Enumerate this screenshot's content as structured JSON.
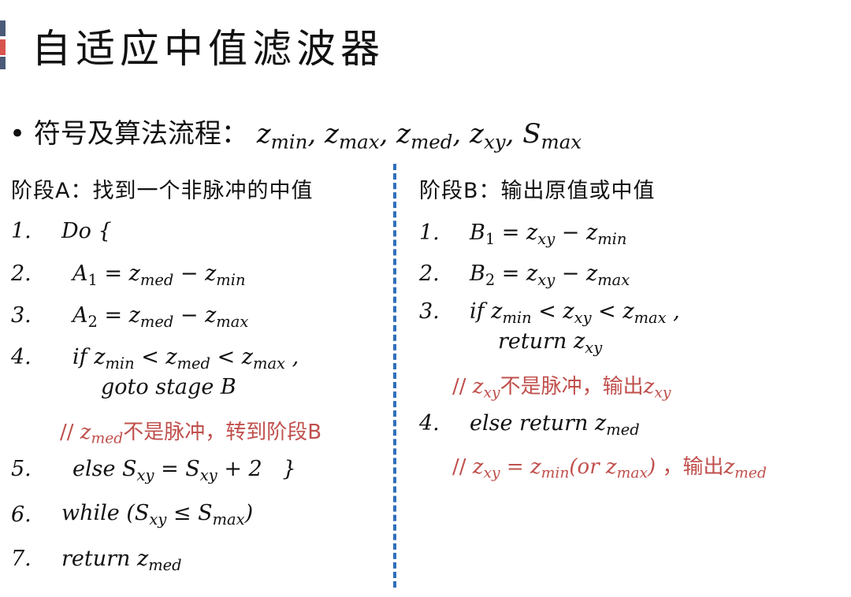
{
  "title": "自适应中值滤波器",
  "bullet": {
    "marker": "•",
    "label": "符号及算法流程：",
    "symbols": "z_min, z_max, z_med, z_xy, S_max"
  },
  "stage_a": {
    "heading": "阶段A：找到一个非脉冲的中值",
    "steps": [
      {
        "num": "1.",
        "text": "Do {"
      },
      {
        "num": "2.",
        "text": "A1 = z_med − z_min"
      },
      {
        "num": "3.",
        "text": "A2 = z_med − z_max"
      },
      {
        "num": "4.",
        "text": "if z_min < z_med < z_max ,",
        "cont": "goto stage B"
      },
      {
        "num": "5.",
        "text": "else S_xy = S_xy + 2   }"
      },
      {
        "num": "6.",
        "text": "while (S_xy ≤ S_max)"
      },
      {
        "num": "7.",
        "text": "return z_med"
      }
    ],
    "comment": "// z_med 不是脉冲，转到阶段B"
  },
  "stage_b": {
    "heading": "阶段B：输出原值或中值",
    "steps": [
      {
        "num": "1.",
        "text": "B1 = z_xy − z_min"
      },
      {
        "num": "2.",
        "text": "B2 = z_xy − z_max"
      },
      {
        "num": "3.",
        "text": "if z_min < z_xy < z_max ,",
        "cont": "return z_xy"
      },
      {
        "num": "4.",
        "text": "else return z_med"
      }
    ],
    "comment1": "// z_xy 不是脉冲，输出z_xy",
    "comment2": "// z_xy = z_min(or z_max) ，输出z_med"
  },
  "colors": {
    "accent_top": "#4a5a78",
    "accent_mid": "#d9534f",
    "accent_bottom": "#4a5a78",
    "divider": "#2f6fba",
    "comment": "#c0504d"
  }
}
